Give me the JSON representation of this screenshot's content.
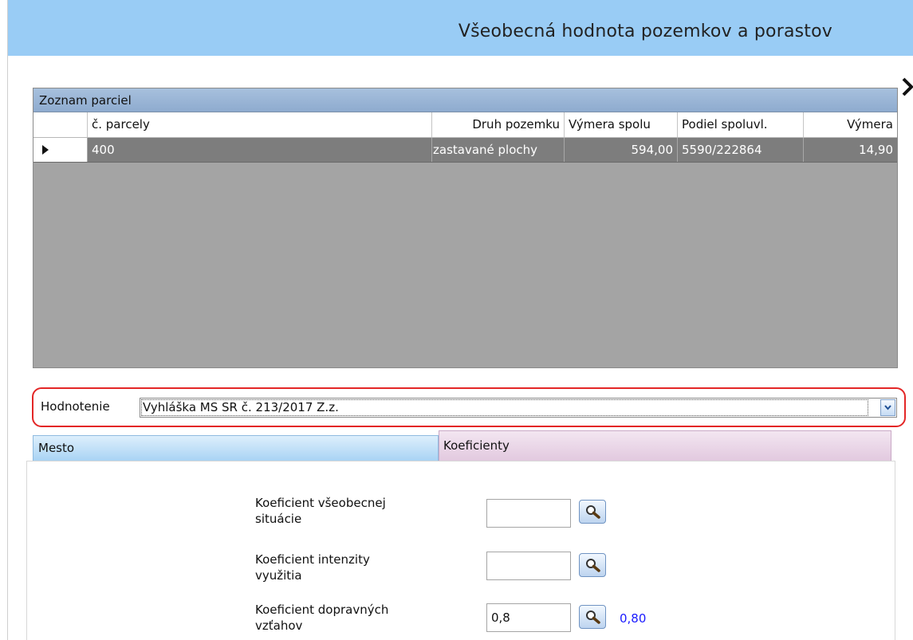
{
  "window": {
    "title": "Všeobecná hodnota pozemkov a porastov"
  },
  "grid": {
    "caption": "Zoznam parciel",
    "columns": [
      "č. parcely",
      "Druh pozemku",
      "Výmera spolu",
      "Podiel spoluvl.",
      "Výmera"
    ],
    "rows": [
      {
        "parcela": "400",
        "druh": "zastavané plochy",
        "vymera_spolu": "594,00",
        "podiel": "5590/222864",
        "vymera": "14,90"
      }
    ]
  },
  "hodnotenie": {
    "label": "Hodnotenie",
    "value": "Vyhláška MS SR č. 213/2017 Z.z."
  },
  "tabs": [
    {
      "label": "Mesto",
      "active": false
    },
    {
      "label": "Koeficienty",
      "active": true
    }
  ],
  "koeficienty": [
    {
      "label_line1": "Koeficient všeobecnej",
      "label_line2": "situácie",
      "value": "",
      "result": ""
    },
    {
      "label_line1": "Koeficient intenzity",
      "label_line2": "využitia",
      "value": "",
      "result": ""
    },
    {
      "label_line1": "Koeficient dopravných",
      "label_line2": "vzťahov",
      "value": "0,8",
      "result": "0,80"
    }
  ],
  "colors": {
    "titlebar": "#99ccf5",
    "grid_caption": "#8eabcf",
    "selected_row": "#7d7d7d",
    "grid_empty": "#a4a4a4",
    "highlight_border": "#e32626",
    "tab_mesto": "#a9d3f4",
    "tab_koeficienty": "#e2c9df",
    "result_text": "#1a1aff"
  },
  "icons": [
    "next-arrow-icon",
    "row-pointer-icon",
    "chevron-down-icon",
    "magnifier-icon"
  ]
}
